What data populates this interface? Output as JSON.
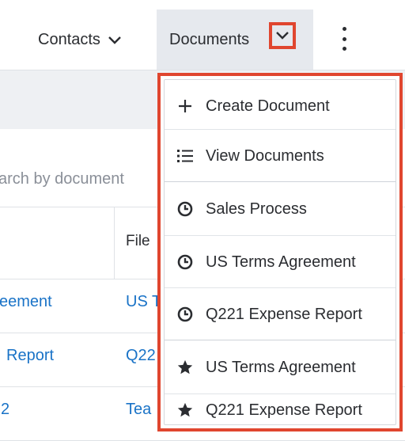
{
  "nav": {
    "contacts_label": "Contacts",
    "documents_label": "Documents"
  },
  "list": {
    "search_placeholder": "arch by document",
    "column_file_header": "File",
    "rows": [
      {
        "name": "eement",
        "file": "US T"
      },
      {
        "name": "Report",
        "file": "Q22"
      },
      {
        "name": "2",
        "file": "Tea"
      }
    ]
  },
  "dropdown": {
    "items": [
      {
        "icon": "plus-icon",
        "label": "Create Document"
      },
      {
        "icon": "list-icon",
        "label": "View Documents"
      },
      {
        "icon": "clock-icon",
        "label": "Sales Process"
      },
      {
        "icon": "clock-icon",
        "label": "US Terms Agreement"
      },
      {
        "icon": "clock-icon",
        "label": "Q221 Expense Report"
      },
      {
        "icon": "star-icon",
        "label": "US Terms Agreement"
      },
      {
        "icon": "star-icon",
        "label": "Q221 Expense Report"
      }
    ]
  },
  "colors": {
    "highlight": "#e0462f",
    "link": "#1a73c7",
    "nav_active_bg": "#e6e9ee"
  }
}
